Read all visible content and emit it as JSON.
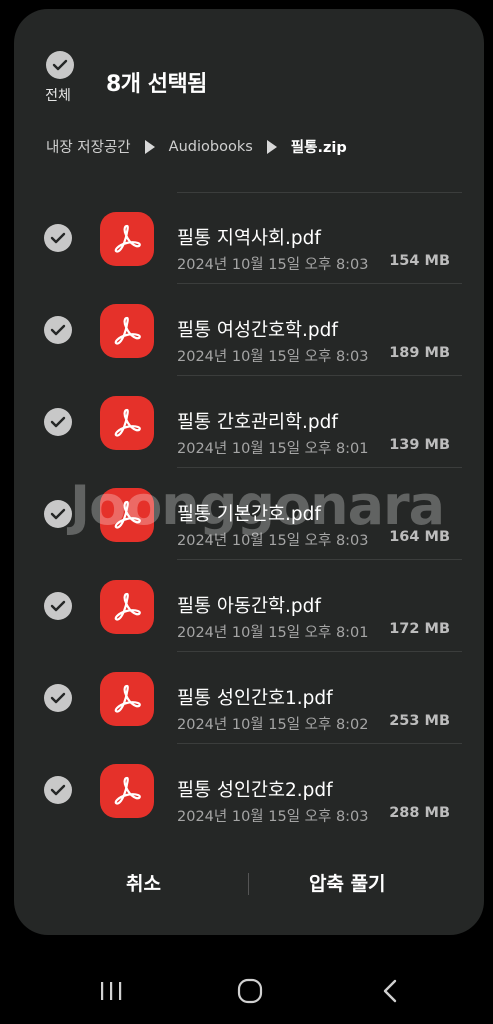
{
  "header": {
    "select_all_label": "전체",
    "title": "8개 선택됨"
  },
  "breadcrumb": {
    "items": [
      "내장 저장공간",
      "Audiobooks",
      "필통.zip"
    ]
  },
  "files": [
    {
      "name": "필통 지역사회.pdf",
      "date": "2024년 10월 15일 오후 8:03",
      "size": "154 MB",
      "icon": "pdf-icon",
      "selected": true
    },
    {
      "name": "필통 여성간호학.pdf",
      "date": "2024년 10월 15일 오후 8:03",
      "size": "189 MB",
      "icon": "pdf-icon",
      "selected": true
    },
    {
      "name": "필통 간호관리학.pdf",
      "date": "2024년 10월 15일 오후 8:01",
      "size": "139 MB",
      "icon": "pdf-icon",
      "selected": true
    },
    {
      "name": "필통 기본간호.pdf",
      "date": "2024년 10월 15일 오후 8:03",
      "size": "164 MB",
      "icon": "pdf-icon",
      "selected": true
    },
    {
      "name": "필통 아동간학.pdf",
      "date": "2024년 10월 15일 오후 8:01",
      "size": "172 MB",
      "icon": "pdf-icon",
      "selected": true
    },
    {
      "name": "필통 성인간호1.pdf",
      "date": "2024년 10월 15일 오후 8:02",
      "size": "253 MB",
      "icon": "pdf-icon",
      "selected": true
    },
    {
      "name": "필통 성인간호2.pdf",
      "date": "2024년 10월 15일 오후 8:03",
      "size": "288 MB",
      "icon": "pdf-icon",
      "selected": true
    }
  ],
  "actions": {
    "cancel_label": "취소",
    "extract_label": "압축 풀기"
  },
  "watermark": "Joonggonara",
  "colors": {
    "sheet_bg": "#252726",
    "pdf_red": "#e5312a",
    "check_gray": "#c8c8c8"
  }
}
